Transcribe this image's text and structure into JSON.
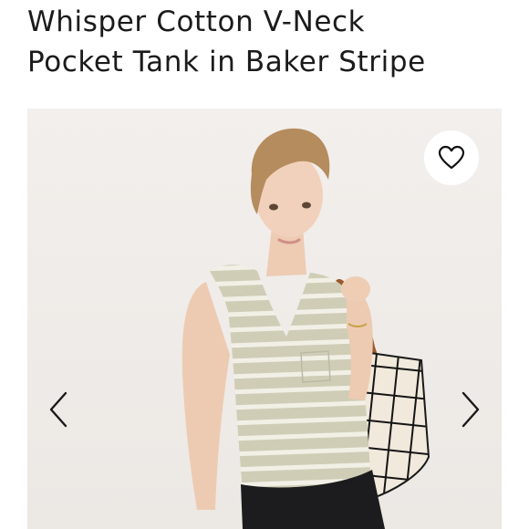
{
  "product": {
    "title_line1": "Whisper Cotton V-Neck",
    "title_line2": "Pocket Tank in Baker Stripe"
  },
  "gallery": {
    "favorite_icon": "heart-outline-icon",
    "prev_icon": "chevron-left-icon",
    "next_icon": "chevron-right-icon"
  },
  "colors": {
    "text": "#1b1b1b",
    "background": "#ffffff",
    "photo_background": "#efebe8",
    "stripe_base": "#cfcdb6",
    "stripe_line": "#f2f0e6",
    "strap": "#9a5a2c"
  }
}
